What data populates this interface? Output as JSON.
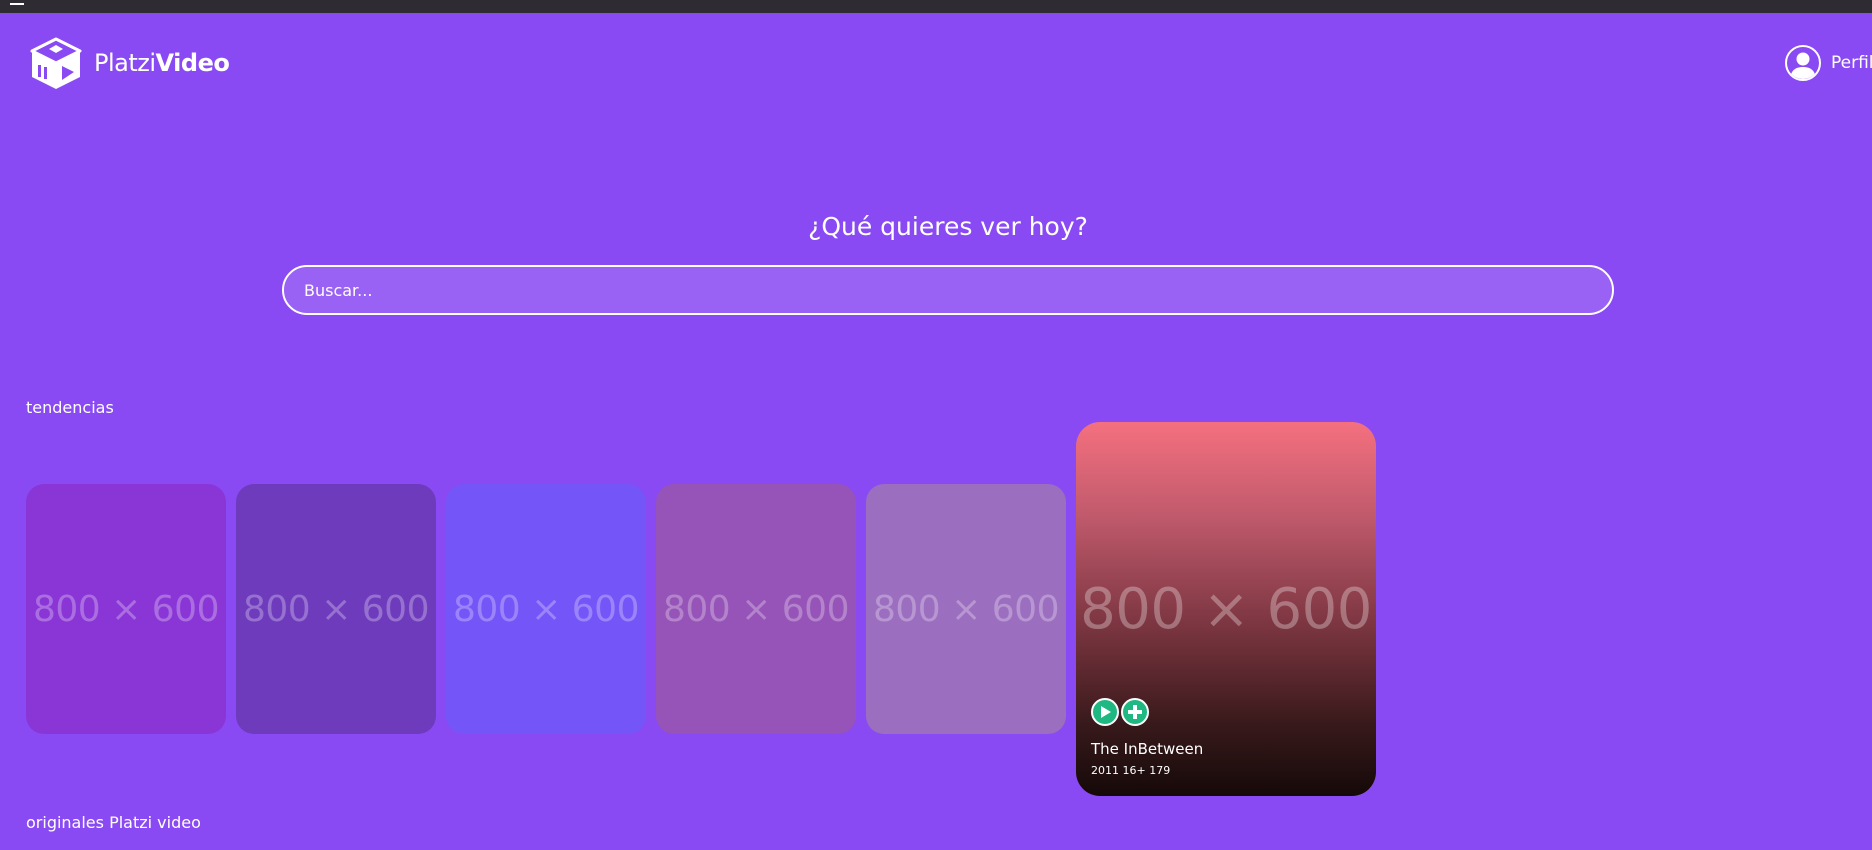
{
  "header": {
    "logo_text_light": "Platzi",
    "logo_text_bold": "Video",
    "profile_label": "Perfil"
  },
  "hero": {
    "title": "¿Qué quieres ver hoy?",
    "search_placeholder": "Buscar..."
  },
  "sections": {
    "trending_title": "tendencias",
    "originals_title": "originales Platzi video"
  },
  "trending_cards": [
    {
      "placeholder": "800 × 600",
      "color": "#8a36d6"
    },
    {
      "placeholder": "800 × 600",
      "color": "#6e3bbd"
    },
    {
      "placeholder": "800 × 600",
      "color": "#7455f7"
    },
    {
      "placeholder": "800 × 600",
      "color": "#9654b8"
    },
    {
      "placeholder": "800 × 600",
      "color": "#9b6ec0"
    }
  ],
  "featured_card": {
    "placeholder": "800 × 600",
    "title": "The InBetween",
    "meta": "2011 16+ 179",
    "controls": [
      "play-icon",
      "plus-icon"
    ],
    "accent": "#1fb882"
  },
  "colors": {
    "background": "#8a4af3",
    "topbar": "#2e2b33"
  }
}
